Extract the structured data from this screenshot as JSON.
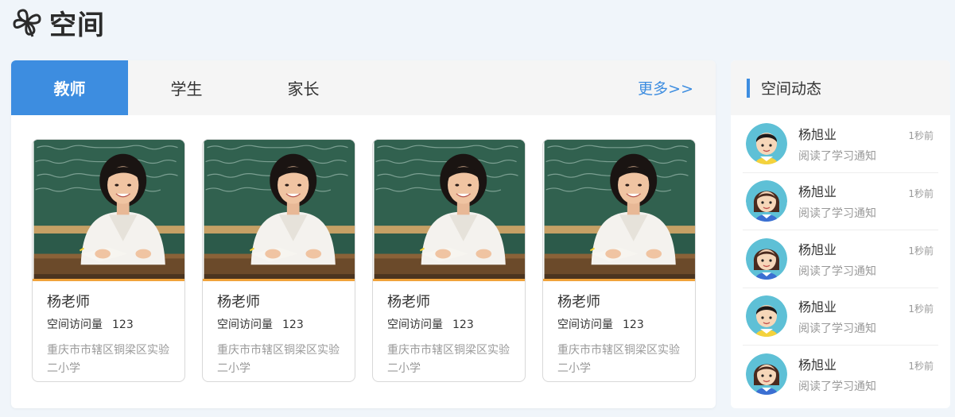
{
  "header": {
    "title": "空间"
  },
  "tabs": [
    {
      "label": "教师"
    },
    {
      "label": "学生"
    },
    {
      "label": "家长"
    }
  ],
  "more_label": "更多>>",
  "cards": [
    {
      "name": "杨老师",
      "visits_label": "空间访问量",
      "visits": "123",
      "school": "重庆市市辖区铜梁区实验二小学"
    },
    {
      "name": "杨老师",
      "visits_label": "空间访问量",
      "visits": "123",
      "school": "重庆市市辖区铜梁区实验二小学"
    },
    {
      "name": "杨老师",
      "visits_label": "空间访问量",
      "visits": "123",
      "school": "重庆市市辖区铜梁区实验二小学"
    },
    {
      "name": "杨老师",
      "visits_label": "空间访问量",
      "visits": "123",
      "school": "重庆市市辖区铜梁区实验二小学"
    }
  ],
  "side": {
    "title": "空间动态",
    "items": [
      {
        "name": "杨旭业",
        "action": "阅读了学习通知",
        "time": "1秒前",
        "avatar": "boy-avatar"
      },
      {
        "name": "杨旭业",
        "action": "阅读了学习通知",
        "time": "1秒前",
        "avatar": "girl-avatar"
      },
      {
        "name": "杨旭业",
        "action": "阅读了学习通知",
        "time": "1秒前",
        "avatar": "girl-avatar"
      },
      {
        "name": "杨旭业",
        "action": "阅读了学习通知",
        "time": "1秒前",
        "avatar": "boy-avatar"
      },
      {
        "name": "杨旭业",
        "action": "阅读了学习通知",
        "time": "1秒前",
        "avatar": "girl-avatar"
      }
    ]
  },
  "colors": {
    "accent": "#3d8de0",
    "photo_border": "#f0a33b",
    "background": "#f0f5fa"
  }
}
